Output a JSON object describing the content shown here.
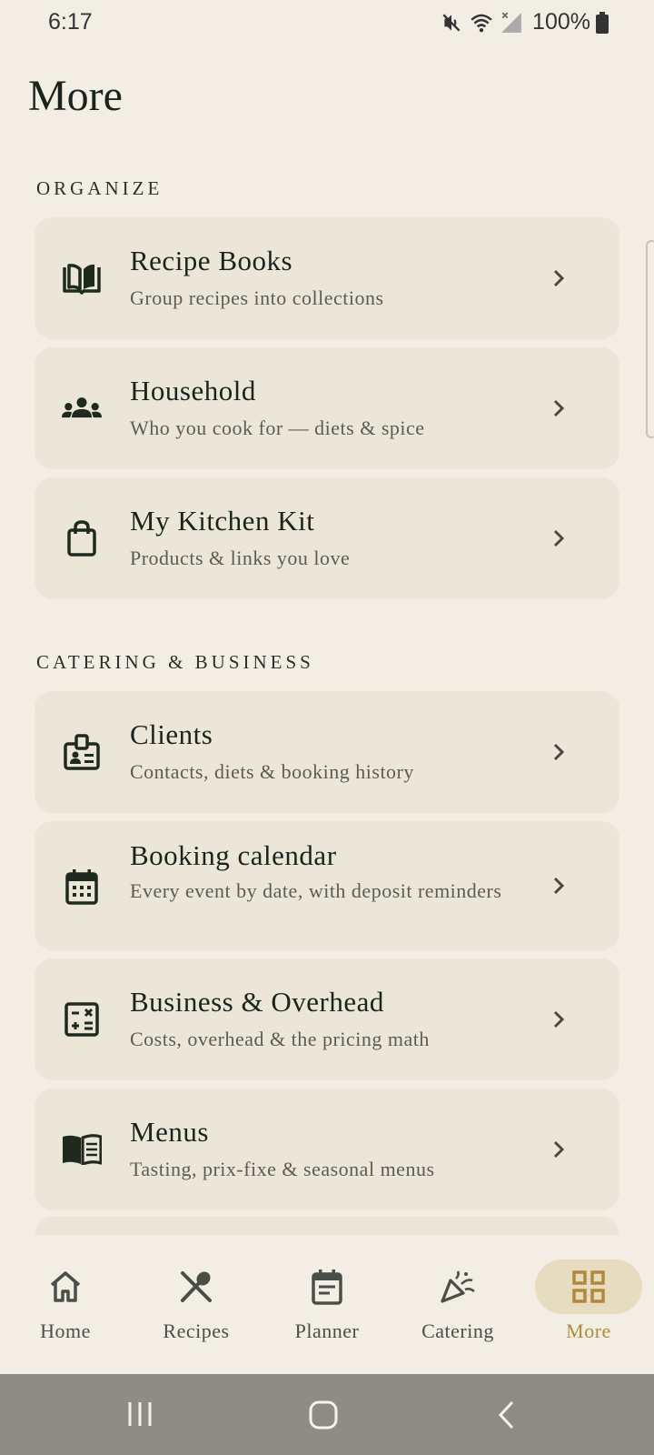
{
  "status_bar": {
    "time": "6:17",
    "battery": "100%",
    "icons": [
      "mute-icon",
      "wifi-icon",
      "signal-icon",
      "battery-icon"
    ]
  },
  "page": {
    "title": "More"
  },
  "sections": [
    {
      "label": "ORGANIZE"
    },
    {
      "label": "CATERING & BUSINESS"
    }
  ],
  "items": [
    {
      "title": "Recipe Books",
      "subtitle": "Group recipes into collections",
      "icon": "book-open-icon"
    },
    {
      "title": "Household",
      "subtitle": "Who you cook for — diets & spice",
      "icon": "people-icon"
    },
    {
      "title": "My Kitchen Kit",
      "subtitle": "Products & links you love",
      "icon": "shopping-bag-icon"
    },
    {
      "title": "Clients",
      "subtitle": "Contacts, diets & booking history",
      "icon": "contact-badge-icon"
    },
    {
      "title": "Booking calendar",
      "subtitle": "Every event by date, with deposit reminders",
      "icon": "calendar-icon"
    },
    {
      "title": "Business & Overhead",
      "subtitle": "Costs, overhead & the pricing math",
      "icon": "calculator-icon"
    },
    {
      "title": "Menus",
      "subtitle": "Tasting, prix-fixe & seasonal menus",
      "icon": "menu-book-icon"
    }
  ],
  "bottom_nav": [
    {
      "label": "Home",
      "icon": "home-icon",
      "active": false
    },
    {
      "label": "Recipes",
      "icon": "utensils-icon",
      "active": false
    },
    {
      "label": "Planner",
      "icon": "planner-icon",
      "active": false
    },
    {
      "label": "Catering",
      "icon": "party-popper-icon",
      "active": false
    },
    {
      "label": "More",
      "icon": "grid-icon",
      "active": true
    }
  ],
  "colors": {
    "background": "#f2eee4",
    "card": "#ebe6d8",
    "text": "#1b241c",
    "accent": "#b08a3c",
    "active_pill": "#e7dcc0"
  }
}
